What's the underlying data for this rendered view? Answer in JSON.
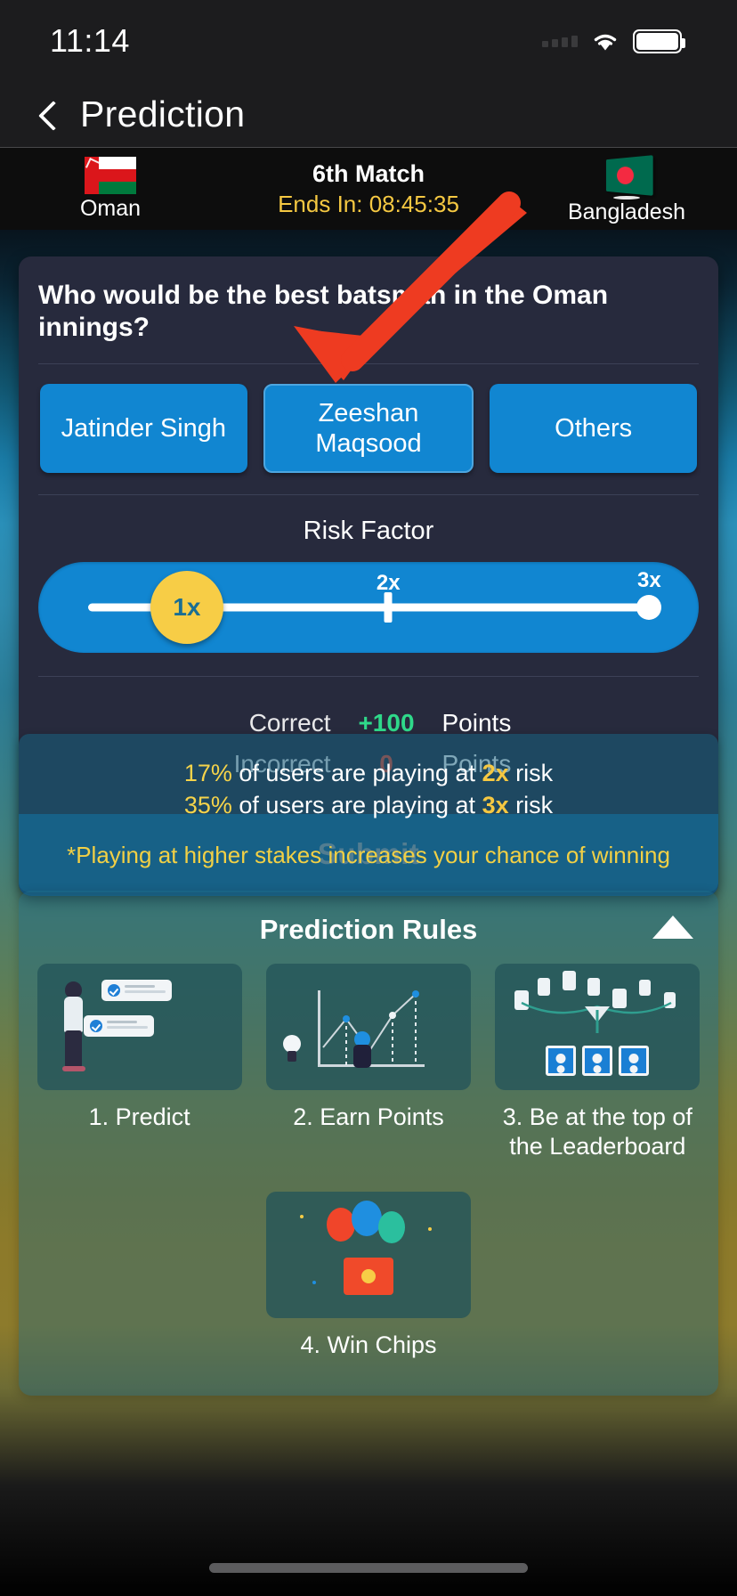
{
  "status_bar": {
    "time": "11:14",
    "signal_icon": "cellular-signal-icon",
    "wifi_icon": "wifi-icon",
    "battery_icon": "battery-icon"
  },
  "nav": {
    "back_icon": "back-chevron-icon",
    "title": "Prediction"
  },
  "match": {
    "team_left": "Oman",
    "team_left_flag": "oman-flag-icon",
    "team_right": "Bangladesh",
    "team_right_flag": "bangladesh-flag-icon",
    "title": "6th Match",
    "timer_label": "Ends In: 08:45:35"
  },
  "prediction": {
    "question": "Who would be the best batsman in the Oman innings?",
    "options": [
      {
        "label": "Jatinder Singh",
        "selected": false
      },
      {
        "label": "Zeeshan Maqsood",
        "selected": true
      },
      {
        "label": "Others",
        "selected": false
      }
    ],
    "risk_label": "Risk Factor",
    "slider": {
      "current_value": "1x",
      "ticks": [
        "2x",
        "3x"
      ],
      "knob_color": "#f7cd46",
      "track_color": "#ffffff",
      "bar_color": "#1186d1"
    },
    "points": [
      {
        "label": "Correct",
        "value": "+100",
        "unit": "Points",
        "tone": "pos"
      },
      {
        "label": "Incorrect",
        "value": "0",
        "unit": "Points",
        "tone": "neg"
      }
    ],
    "submit_label": "Submit"
  },
  "stats": {
    "lines": [
      {
        "pct": "17%",
        "mid": "of users are playing at",
        "mult": "2x",
        "tail": "risk"
      },
      {
        "pct": "35%",
        "mid": "of users are playing at",
        "mult": "3x",
        "tail": "risk"
      }
    ],
    "note": "*Playing at higher stakes increases your chance of winning"
  },
  "rules": {
    "title": "Prediction Rules",
    "collapse_icon": "caret-up-icon",
    "items": [
      {
        "label": "1. Predict",
        "thumb": "predict-illustration"
      },
      {
        "label": "2. Earn Points",
        "thumb": "chart-illustration"
      },
      {
        "label": "3. Be at the top of the Leaderboard",
        "thumb": "leaderboard-illustration"
      },
      {
        "label": "4. Win Chips",
        "thumb": "balloons-chips-illustration"
      }
    ]
  },
  "annotation": {
    "arrow_icon": "red-pointer-arrow",
    "arrow_color": "#ee3b21",
    "points_to": "Zeeshan Maqsood"
  },
  "home_indicator": "home-indicator"
}
